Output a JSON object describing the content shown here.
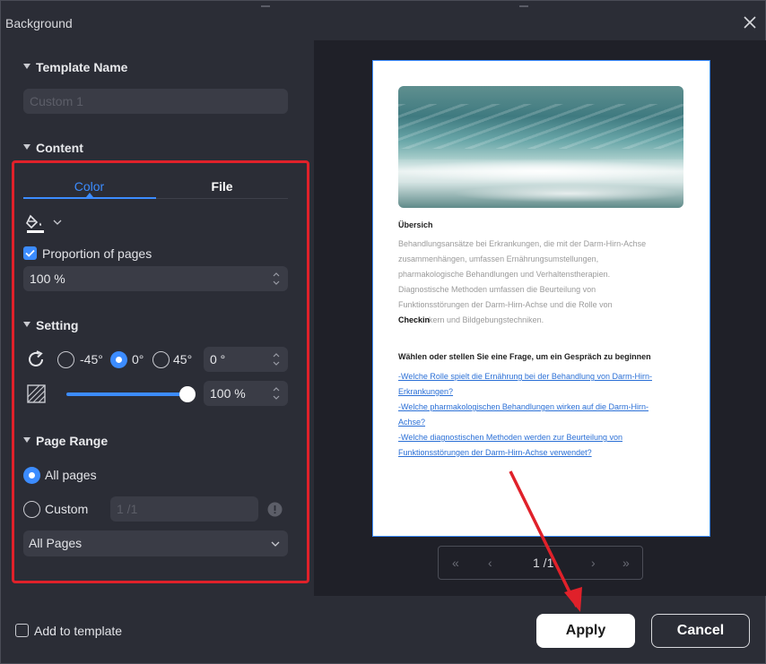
{
  "window": {
    "title": "Background"
  },
  "template": {
    "section": "Template Name",
    "placeholder": "Custom 1"
  },
  "content": {
    "section": "Content",
    "tabs": [
      "Color",
      "File"
    ],
    "active_tab": "Color",
    "proportion_label": "Proportion of pages",
    "proportion_checked": true,
    "proportion_value": "100 %"
  },
  "setting": {
    "section": "Setting",
    "rotation_options": [
      "-45°",
      "0°",
      "45°"
    ],
    "rotation_selected": "0°",
    "rotation_value": "0 °",
    "opacity_value": "100 %",
    "opacity_fraction": 1.0
  },
  "page_range": {
    "section": "Page Range",
    "all_pages_label": "All pages",
    "custom_label": "Custom",
    "custom_value": "1 /1",
    "selected": "All pages",
    "dropdown_value": "All Pages"
  },
  "preview": {
    "heading": "Übersich",
    "paragraph_lines": [
      "Behandlungsansätze bei Erkrankungen, die mit der Darm-Hirn-Achse",
      "zusammenhängen, umfassen Ernährungsumstellungen,",
      "pharmakologische Behandlungen und Verhaltenstherapien.",
      "Diagnostische Methoden umfassen die Beurteilung von",
      "Funktionsstörungen der Darm-Hirn-Achse und die Rolle von",
      "kern und Bildgebungstechniken."
    ],
    "checkin": "Checkin",
    "question_heading": "Wählen oder stellen Sie eine Frage, um ein Gespräch zu beginnen",
    "links": [
      "-Welche Rolle spielt die Ernährung bei der Behandlung von Darm-Hirn-",
      "Erkrankungen?",
      "-Welche pharmakologischen Behandlungen wirken auf die Darm-Hirn-",
      "Achse?",
      "-Welche diagnostischen Methoden werden zur Beurteilung von",
      "Funktionsstörungen der Darm-Hirn-Achse verwendet?"
    ],
    "pager": {
      "first": "«",
      "prev": "‹",
      "page": "1 /1",
      "next": "›",
      "last": "»"
    }
  },
  "footer": {
    "add_template_label": "Add to template",
    "apply_label": "Apply",
    "cancel_label": "Cancel"
  },
  "colors": {
    "accent": "#3c8cff",
    "highlight": "#e0212a",
    "panel": "#2b2d36",
    "preview_bg": "#1f2028"
  },
  "icons": [
    "close-icon",
    "paint-bucket-icon",
    "rotate-icon",
    "opacity-icon",
    "info-icon",
    "chevron-down-icon"
  ]
}
